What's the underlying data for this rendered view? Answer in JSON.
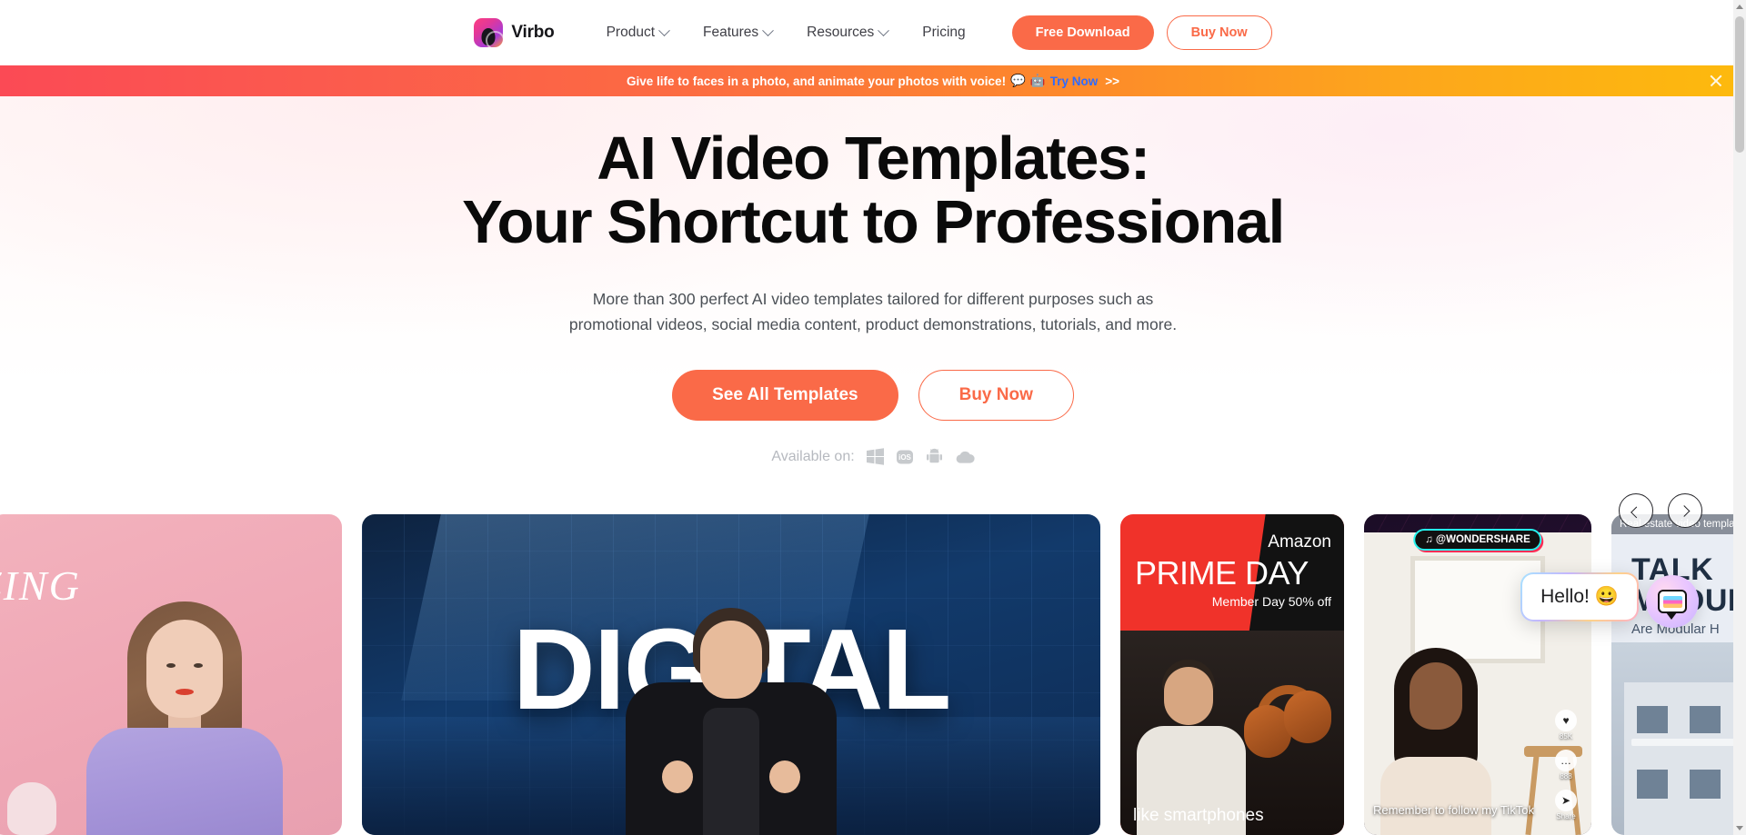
{
  "nav": {
    "brand": "Virbo",
    "brand_logo_icon": "virbo-logo-icon",
    "links": [
      {
        "label": "Product",
        "has_caret": true
      },
      {
        "label": "Features",
        "has_caret": true
      },
      {
        "label": "Resources",
        "has_caret": true
      },
      {
        "label": "Pricing",
        "has_caret": false
      }
    ],
    "free_download_label": "Free Download",
    "buy_now_label": "Buy Now"
  },
  "promo": {
    "text": "Give life to faces in a photo, and animate your photos with voice!",
    "emoji1": "💬",
    "emoji2": "🤖",
    "link_label": "Try Now",
    "arrows": ">>",
    "close_icon": "close-icon",
    "gradient_start": "#fb4a55",
    "gradient_end": "#fdba0d"
  },
  "hero": {
    "title_line1": "AI Video Templates:",
    "title_line2": "Your Shortcut to Professional",
    "subtitle_line1": "More than 300 perfect AI video templates tailored for different purposes such as",
    "subtitle_line2": "promotional videos, social media content, product demonstrations, tutorials, and more.",
    "cta_primary": "See All Templates",
    "cta_secondary": "Buy Now",
    "available_label": "Available on:",
    "platforms": [
      {
        "name": "windows-icon",
        "glyph": ""
      },
      {
        "name": "ios-icon",
        "glyph": "iOS"
      },
      {
        "name": "android-icon",
        "glyph": ""
      },
      {
        "name": "cloud-icon",
        "glyph": ""
      }
    ],
    "accent_color": "#fa6a48"
  },
  "carousel": {
    "prev_icon": "chevron-left-icon",
    "next_icon": "chevron-right-icon"
  },
  "cards": [
    {
      "name": "pink-template-card",
      "script_text": "ZING"
    },
    {
      "name": "digital-template-card",
      "word": "DIGITAL"
    },
    {
      "name": "prime-day-template-card",
      "amazon": "Amazon",
      "title": "PRIME DAY",
      "subtitle": "Member Day 50% off",
      "caption": "like smartphones"
    },
    {
      "name": "tiktok-template-card",
      "badge": "@WONDERSHARE",
      "badge_icon": "tiktok-note-icon",
      "caption": "Remember to follow my TikTok",
      "rail": [
        {
          "icon": "heart-icon",
          "glyph": "♥",
          "count": "85K"
        },
        {
          "icon": "comment-icon",
          "glyph": "…",
          "count": "888"
        },
        {
          "icon": "share-icon",
          "glyph": "➤",
          "count": "Share"
        }
      ]
    },
    {
      "name": "real-estate-template-card",
      "tag": "Real estate video template",
      "headline1": "TALK",
      "headline2": "MODULAR",
      "question": "Are Modular H"
    }
  ],
  "chat": {
    "bubble_text": "Hello!",
    "bubble_emoji": "😀",
    "fab_icon": "chat-widget-icon"
  },
  "scrollbar": {
    "up_icon": "scroll-up-arrow-icon",
    "down_icon": "scroll-down-arrow-icon"
  }
}
